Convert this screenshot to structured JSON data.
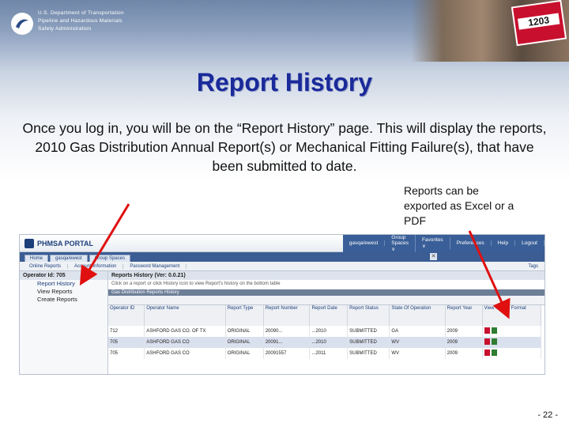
{
  "agency": {
    "line1": "U.S. Department of Transportation",
    "line2": "Pipeline and Hazardous Materials",
    "line3": "Safety Administration"
  },
  "header_photo": {
    "placard_text": "1203"
  },
  "title": "Report History",
  "intro": "Once you log in, you will be on the “Report History” page.  This will display the reports, 2010 Gas Distribution Annual Report(s) or Mechanical Fitting Failure(s), that have been submitted to date.",
  "callout": "Reports can be exported as Excel or a PDF",
  "portal": {
    "logo": "PHMSA PORTAL",
    "menu": [
      "gasqa/ewest",
      "Group Spaces ∨",
      "Favorites ∨",
      "Preferences",
      "Help",
      "Logout"
    ],
    "tabs": [
      "Home",
      "gasqa/ewest",
      "Group Spaces"
    ],
    "tab_close": "✕",
    "toolbar": [
      "Online Reports",
      "Account Information",
      "Password Management"
    ],
    "tags_label": "Tags",
    "operator_label": "Operator Id: 705",
    "nav_items": [
      "Report History",
      "View Reports",
      "Create Reports"
    ],
    "pane_title": "Reports History (Ver: 0.0.21)",
    "pane_hint": "Click on a report or click History icon to view Report's history on the bottom table",
    "grid_title": "Gas Distribution Reports History",
    "columns": [
      "Operator ID",
      "Operator Name",
      "Report Type",
      "Report Number",
      "Report Date",
      "Report Status",
      "State Of Operation",
      "Report Year",
      "View Report Format"
    ],
    "rows": [
      [
        "712",
        "ASHFORD GAS CO. OF TX",
        "ORIGINAL",
        "20090...",
        "...2010",
        "SUBMITTED",
        "GA",
        "2009"
      ],
      [
        "705",
        "ASHFORD GAS CO",
        "ORIGINAL",
        "20091...",
        "...2010",
        "SUBMITTED",
        "WV",
        "2009"
      ],
      [
        "705",
        "ASHFORD GAS CO",
        "ORIGINAL",
        "20091557",
        "...2011",
        "SUBMITTED",
        "WV",
        "2009"
      ]
    ]
  },
  "slide_number": "- 22 -",
  "colors": {
    "title": "#1a2a9a",
    "arrow": "#e01010",
    "portal_nav": "#3a5f98"
  }
}
